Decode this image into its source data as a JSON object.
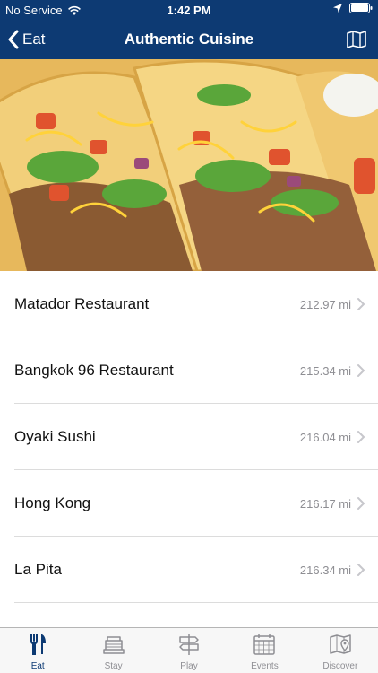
{
  "status_bar": {
    "carrier": "No Service",
    "time": "1:42 PM"
  },
  "nav": {
    "back_label": "Eat",
    "title": "Authentic Cuisine"
  },
  "restaurants": [
    {
      "name": "Matador Restaurant",
      "distance": "212.97 mi"
    },
    {
      "name": "Bangkok 96 Restaurant",
      "distance": "215.34 mi"
    },
    {
      "name": "Oyaki Sushi",
      "distance": "216.04 mi"
    },
    {
      "name": "Hong Kong",
      "distance": "216.17 mi"
    },
    {
      "name": "La Pita",
      "distance": "216.34 mi"
    }
  ],
  "tabs": [
    {
      "label": "Eat",
      "icon": "fork-knife-icon",
      "active": true
    },
    {
      "label": "Stay",
      "icon": "bed-icon",
      "active": false
    },
    {
      "label": "Play",
      "icon": "signpost-icon",
      "active": false
    },
    {
      "label": "Events",
      "icon": "calendar-icon",
      "active": false
    },
    {
      "label": "Discover",
      "icon": "map-pin-icon",
      "active": false
    }
  ],
  "colors": {
    "nav_background": "#0d3a73",
    "active_tab": "#0d3a73",
    "inactive_tab": "#8e8e93"
  }
}
